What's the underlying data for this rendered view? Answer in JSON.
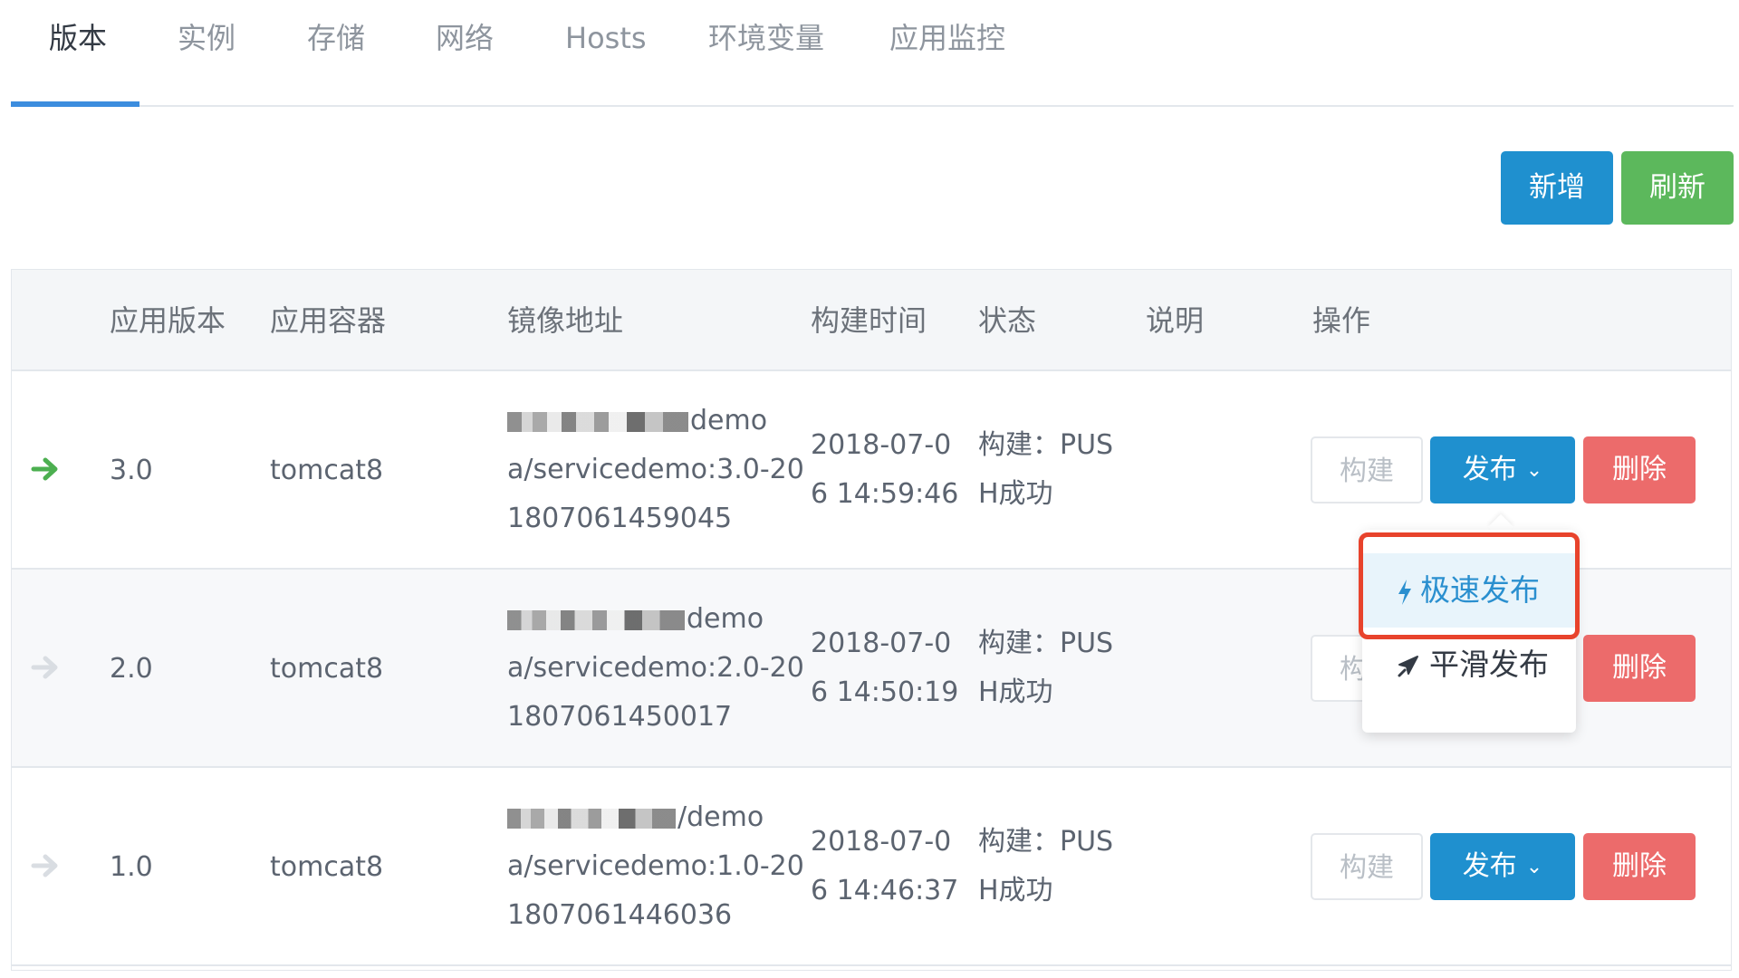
{
  "tabs": [
    {
      "label": "版本"
    },
    {
      "label": "实例"
    },
    {
      "label": "存储"
    },
    {
      "label": "网络"
    },
    {
      "label": "Hosts"
    },
    {
      "label": "环境变量"
    },
    {
      "label": "应用监控"
    }
  ],
  "toolbar": {
    "add_label": "新增",
    "refresh_label": "刷新"
  },
  "table": {
    "headers": [
      "应用版本",
      "应用容器",
      "镜像地址",
      "构建时间",
      "状态",
      "说明",
      "操作"
    ],
    "rows": [
      {
        "version": "3.0",
        "container": "tomcat8",
        "image_line1": "demo",
        "image_line2": "a/servicedemo:3.0-20",
        "image_line3": "1807061459045",
        "time_line1": "2018-07-0",
        "time_line2": "6 14:59:46",
        "status_line1": "构建：PUS",
        "status_line2": "H成功",
        "build_label": "构建",
        "publish_label": "发布",
        "delete_label": "删除",
        "current": true
      },
      {
        "version": "2.0",
        "container": "tomcat8",
        "image_line1": "demo",
        "image_line2": "a/servicedemo:2.0-20",
        "image_line3": "1807061450017",
        "time_line1": "2018-07-0",
        "time_line2": "6 14:50:19",
        "status_line1": "构建：PUS",
        "status_line2": "H成功",
        "build_label": "构",
        "publish_label": "",
        "delete_label": "删除",
        "current": false
      },
      {
        "version": "1.0",
        "container": "tomcat8",
        "image_line1": "/demo",
        "image_line2": "a/servicedemo:1.0-20",
        "image_line3": "1807061446036",
        "time_line1": "2018-07-0",
        "time_line2": "6 14:46:37",
        "status_line1": "构建：PUS",
        "status_line2": "H成功",
        "build_label": "构建",
        "publish_label": "发布",
        "delete_label": "删除",
        "current": false
      }
    ]
  },
  "dropdown": {
    "items": [
      {
        "label": "极速发布",
        "icon": "lightning-icon"
      },
      {
        "label": "平滑发布",
        "icon": "airplane-icon"
      }
    ]
  },
  "colors": {
    "accent": "#1f90cf",
    "success": "#5cb85c",
    "danger": "#ec6b6b",
    "highlight": "#e8432c",
    "active_arrow": "#4caf50",
    "inactive_arrow": "#d9dde2"
  }
}
